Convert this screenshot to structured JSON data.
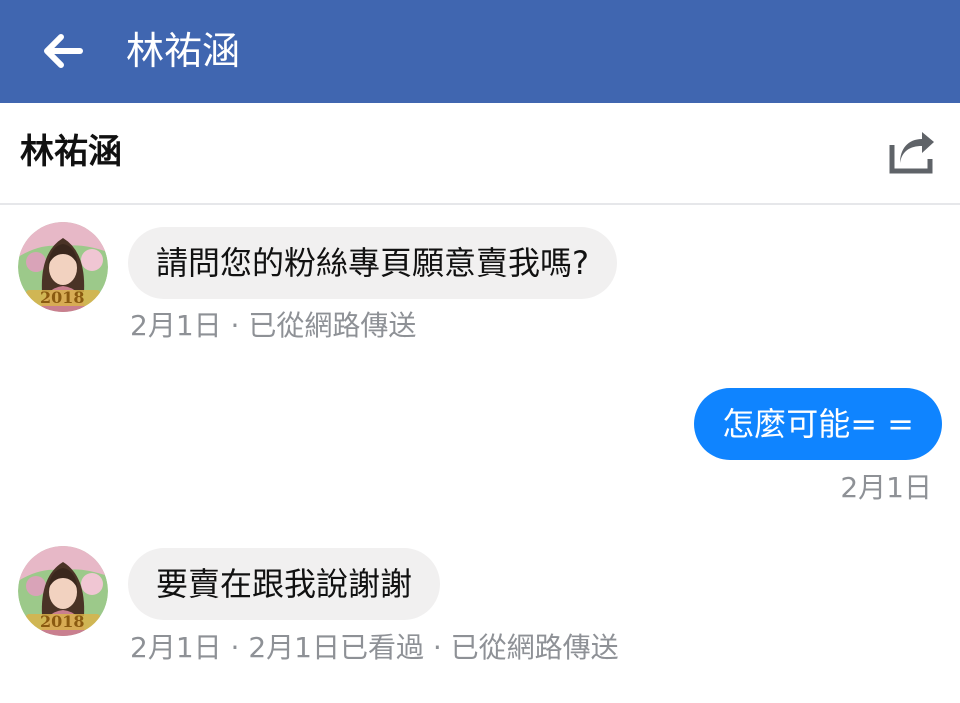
{
  "appbar": {
    "title": "林祐涵",
    "background": "#4066b0",
    "back_icon": "arrow-left-icon"
  },
  "subheader": {
    "name": "林祐涵",
    "share_icon": "share-icon"
  },
  "messages": [
    {
      "direction": "incoming",
      "text": "請問您的粉絲專頁願意賣我嗎?",
      "meta": "2月1日 · 已從網路傳送",
      "avatar_caption": "2018"
    },
    {
      "direction": "outgoing",
      "text": "怎麼可能= =",
      "meta": "2月1日"
    },
    {
      "direction": "incoming",
      "text": "要賣在跟我說謝謝",
      "meta": "2月1日 · 2月1日已看過 · 已從網路傳送",
      "avatar_caption": "2018"
    }
  ],
  "colors": {
    "outgoing_bubble": "#0f84ff",
    "incoming_bubble": "#f1f0f0",
    "meta_text": "#8e9196"
  }
}
